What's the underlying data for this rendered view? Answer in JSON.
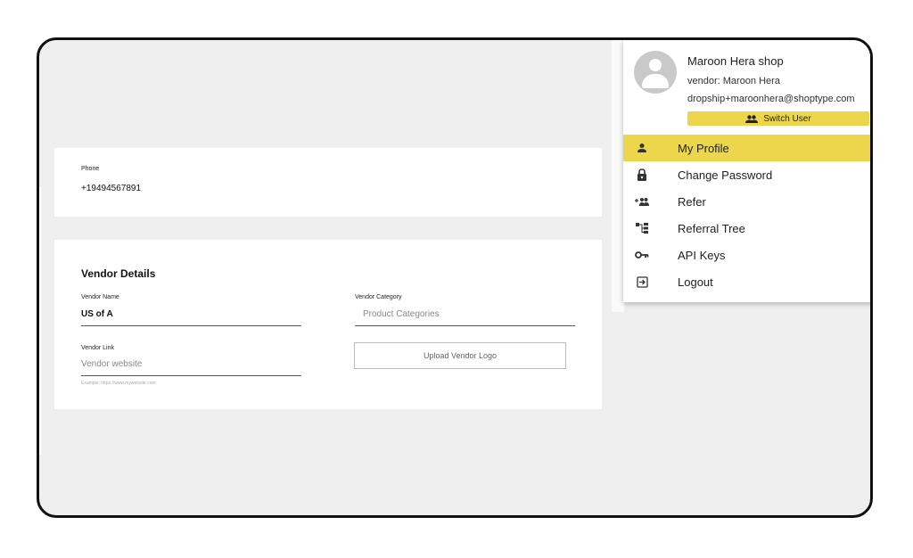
{
  "phone": {
    "label": "Phone",
    "value": "+19494567891"
  },
  "vendor": {
    "title": "Vendor Details",
    "name_label": "Vendor Name",
    "name_value": "US of A",
    "category_label": "Vendor Category",
    "category_placeholder": "Product Categories",
    "link_label": "Vendor Link",
    "link_placeholder": "Vendor website",
    "link_hint": "Example: https://www.mywebsite.com",
    "upload_label": "Upload Vendor Logo"
  },
  "user_menu": {
    "shop_name": "Maroon Hera shop",
    "vendor_line": "vendor: Maroon Hera",
    "email": "dropship+maroonhera@shoptype.com",
    "switch_user": "Switch User",
    "items": [
      {
        "label": "My Profile",
        "icon": "person-icon",
        "active": true
      },
      {
        "label": "Change Password",
        "icon": "lock-icon"
      },
      {
        "label": "Refer",
        "icon": "add-group-icon"
      },
      {
        "label": "Referral Tree",
        "icon": "tree-icon"
      },
      {
        "label": "API Keys",
        "icon": "key-icon"
      },
      {
        "label": "Logout",
        "icon": "logout-icon"
      }
    ]
  },
  "colors": {
    "accent": "#edd64c",
    "background": "#efefef"
  }
}
